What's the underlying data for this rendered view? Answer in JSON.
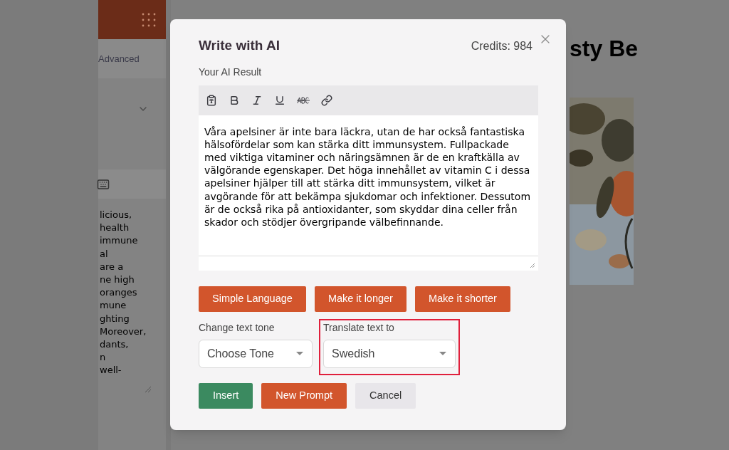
{
  "background": {
    "sidebar_tab": "Advanced",
    "heading": "sty Be",
    "sidebar_text_lines": [
      "licious,",
      "health",
      "immune",
      "al",
      "are a",
      "ne high",
      "oranges",
      "mune",
      "ghting",
      "Moreover,",
      "dants,",
      "n",
      "well-"
    ]
  },
  "dialog": {
    "title": "Write with AI",
    "credits": "Credits: 984",
    "result_label": "Your AI Result",
    "toolbar": [
      {
        "kind": "paste"
      },
      {
        "kind": "bold"
      },
      {
        "kind": "italic"
      },
      {
        "kind": "underline"
      },
      {
        "kind": "strike"
      },
      {
        "kind": "link"
      }
    ],
    "result_text": "Våra apelsiner är inte bara läckra, utan de har också fantastiska hälsofördelar som kan stärka ditt immunsystem. Fullpackade med viktiga vitaminer och näringsämnen är de en kraftkälla av välgörande egenskaper. Det höga innehållet av vitamin C i dessa apelsiner hjälper till att stärka ditt immunsystem, vilket är avgörande för att bekämpa sjukdomar och infektioner. Dessutom är de också rika på antioxidanter, som skyddar dina celler från skador och stödjer övergripande välbefinnande.",
    "rewrite_buttons": [
      "Simple Language",
      "Make it longer",
      "Make it shorter"
    ],
    "selects": [
      {
        "label": "Change text tone",
        "value": "Choose Tone",
        "highlighted": false
      },
      {
        "label": "Translate text to",
        "value": "Swedish",
        "highlighted": true
      }
    ],
    "actions": [
      {
        "label": "Insert",
        "kind": "primary"
      },
      {
        "label": "New Prompt",
        "kind": "accent"
      },
      {
        "label": "Cancel",
        "kind": "plain"
      }
    ]
  }
}
